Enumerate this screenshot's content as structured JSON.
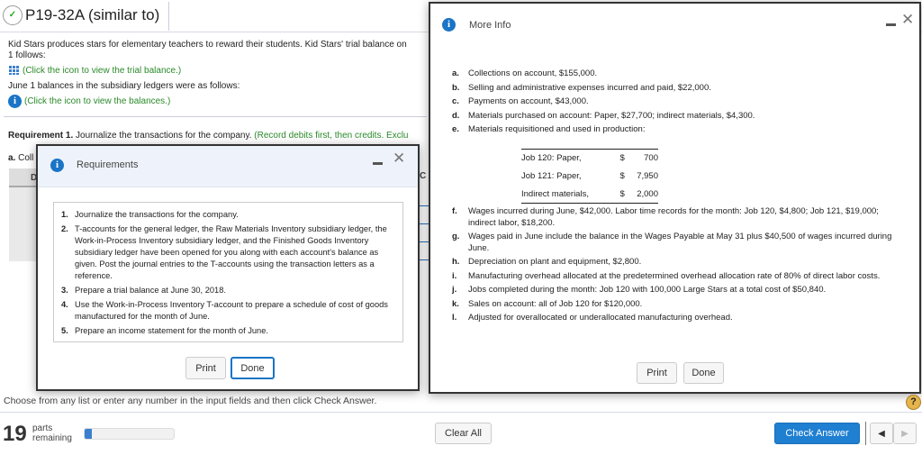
{
  "header": {
    "title": "P19-32A (similar to)",
    "status_icon": "partial-correct-icon"
  },
  "intro": {
    "line1": "Kid Stars produces stars for elementary teachers to reward their students. Kid Stars' trial balance on",
    "line2": "1 follows:",
    "link1": "(Click the icon to view the trial balance.)",
    "line3": "June 1 balances in the subsidiary ledgers were as follows:",
    "link2": "(Click the icon to view the balances.)"
  },
  "requirement": {
    "bold": "Requirement 1.",
    "text": " Journalize the transactions for the company.",
    "hint": " (Record debits first, then credits. Exclu"
  },
  "partial": {
    "a_label": "a.",
    "a_text": " Coll",
    "col_d": "D",
    "col_c": "C"
  },
  "requirements_dialog": {
    "title": "Requirements",
    "items": [
      {
        "n": "1.",
        "text": "Journalize the transactions for the company."
      },
      {
        "n": "2.",
        "text": "T-accounts for the general ledger, the Raw Materials Inventory subsidiary ledger, the Work-in-Process Inventory subsidiary ledger, and the Finished Goods Inventory subsidiary ledger have been opened for you along with each account's balance as given. Post the journal entries to the T-accounts using the transaction letters as a reference."
      },
      {
        "n": "3.",
        "text": "Prepare a trial balance at June 30, 2018."
      },
      {
        "n": "4.",
        "text": "Use the Work-in-Process Inventory T-account to prepare a schedule of cost of goods manufactured for the month of June."
      },
      {
        "n": "5.",
        "text": "Prepare an income statement for the month of June."
      }
    ],
    "print": "Print",
    "done": "Done"
  },
  "more_info_dialog": {
    "title": "More Info",
    "items_top": [
      {
        "n": "a.",
        "text": "Collections on account, $155,000."
      },
      {
        "n": "b.",
        "text": "Selling and administrative expenses incurred and paid, $22,000."
      },
      {
        "n": "c.",
        "text": "Payments on account, $43,000."
      },
      {
        "n": "d.",
        "text": "Materials purchased on account: Paper, $27,700; indirect materials, $4,300."
      },
      {
        "n": "e.",
        "text": "Materials requisitioned and used in production:"
      }
    ],
    "table": [
      {
        "label": "Job 120: Paper,",
        "cur": "$",
        "amount": "700"
      },
      {
        "label": "Job 121: Paper,",
        "cur": "$",
        "amount": "7,950"
      },
      {
        "label": "Indirect materials,",
        "cur": "$",
        "amount": "2,000"
      }
    ],
    "items_bottom": [
      {
        "n": "f.",
        "text": "Wages incurred during June, $42,000. Labor time records for the month: Job 120, $4,800; Job 121, $19,000; indirect labor, $18,200."
      },
      {
        "n": "g.",
        "text": "Wages paid in June include the balance in the Wages Payable at May 31 plus $40,500 of wages incurred during June."
      },
      {
        "n": "h.",
        "text": "Depreciation on plant and equipment, $2,800."
      },
      {
        "n": "i.",
        "text": "Manufacturing overhead allocated at the predetermined overhead allocation rate of 80% of direct labor costs."
      },
      {
        "n": "j.",
        "text": "Jobs completed during the month: Job 120 with 100,000 Large Stars at a total cost of $50,840."
      },
      {
        "n": "k.",
        "text": "Sales on account: all of Job 120 for $120,000."
      },
      {
        "n": "l.",
        "text": "Adjusted for overallocated or underallocated manufacturing overhead."
      }
    ],
    "print": "Print",
    "done": "Done"
  },
  "footer": {
    "instruction": "Choose from any list or enter any number in the input fields and then click Check Answer.",
    "parts_count": "19",
    "parts_label1": "parts",
    "parts_label2": "remaining",
    "progress_fraction": 0.08,
    "clear_all": "Clear All",
    "check_answer": "Check Answer",
    "help": "?"
  },
  "colors": {
    "accent": "#1a74c7",
    "link_green": "#2a8a2a",
    "check_answer_bg": "#1f7fd1"
  }
}
